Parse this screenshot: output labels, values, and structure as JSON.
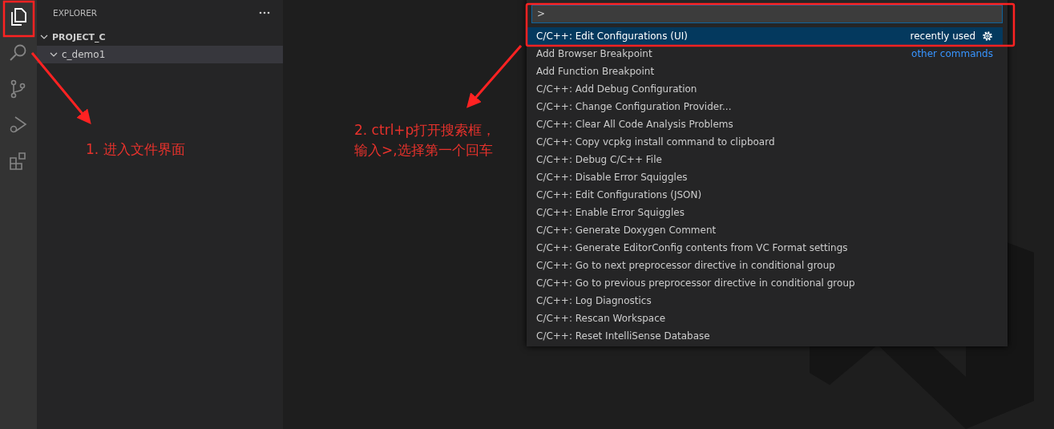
{
  "activity_bar": [
    {
      "kind": "explorer",
      "selected": true
    },
    {
      "kind": "search",
      "selected": false
    },
    {
      "kind": "source-control",
      "selected": false
    },
    {
      "kind": "run-debug",
      "selected": false
    },
    {
      "kind": "extensions",
      "selected": false
    }
  ],
  "sidebar": {
    "title": "EXPLORER",
    "tree": [
      {
        "label": "PROJECT_C",
        "expanded": true,
        "selected": false,
        "children": [
          {
            "label": "c_demo1",
            "expanded": true,
            "selected": true
          }
        ]
      }
    ]
  },
  "command_palette": {
    "value": ">",
    "items": [
      {
        "label": "C/C++: Edit Configurations (UI)",
        "selected": true,
        "group": "recently used"
      },
      {
        "label": "Add Browser Breakpoint",
        "selected": false,
        "group": "other commands"
      },
      {
        "label": "Add Function Breakpoint",
        "selected": false
      },
      {
        "label": "C/C++: Add Debug Configuration",
        "selected": false
      },
      {
        "label": "C/C++: Change Configuration Provider...",
        "selected": false
      },
      {
        "label": "C/C++: Clear All Code Analysis Problems",
        "selected": false
      },
      {
        "label": "C/C++: Copy vcpkg install command to clipboard",
        "selected": false
      },
      {
        "label": "C/C++: Debug C/C++ File",
        "selected": false
      },
      {
        "label": "C/C++: Disable Error Squiggles",
        "selected": false
      },
      {
        "label": "C/C++: Edit Configurations (JSON)",
        "selected": false
      },
      {
        "label": "C/C++: Enable Error Squiggles",
        "selected": false
      },
      {
        "label": "C/C++: Generate Doxygen Comment",
        "selected": false
      },
      {
        "label": "C/C++: Generate EditorConfig contents from VC Format settings",
        "selected": false
      },
      {
        "label": "C/C++: Go to next preprocessor directive in conditional group",
        "selected": false
      },
      {
        "label": "C/C++: Go to previous preprocessor directive in conditional group",
        "selected": false
      },
      {
        "label": "C/C++: Log Diagnostics",
        "selected": false
      },
      {
        "label": "C/C++: Rescan Workspace",
        "selected": false
      },
      {
        "label": "C/C++: Reset IntelliSense Database",
        "selected": false
      }
    ]
  },
  "annotations": [
    {
      "lines": [
        "1. 进入文件界面"
      ]
    },
    {
      "lines": [
        "2. ctrl+p打开搜索框，",
        "输入>,选择第一个回车"
      ]
    }
  ]
}
